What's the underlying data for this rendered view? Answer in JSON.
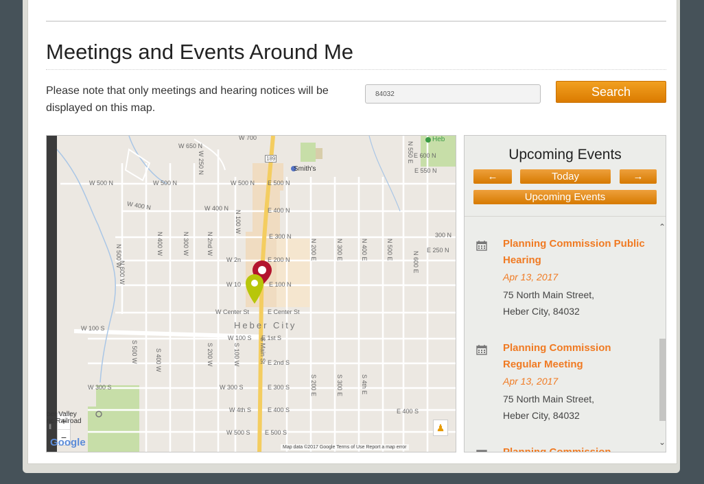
{
  "heading": "Meetings and Events Around Me",
  "note": "Please note that only meetings and hearing notices will be displayed on this map.",
  "search": {
    "value": "84032",
    "button_label": "Search"
  },
  "map": {
    "city_label": "Heber City",
    "google_logo": "Google",
    "attribution": "Map data ©2017 Google   Terms of Use   Report a map error",
    "zoom_in": "+",
    "zoom_out": "−",
    "place_labels": {
      "smiths": "Smith's",
      "heb": "Heb",
      "railroad_1": "ber Valley",
      "railroad_2": "ric Railroad",
      "hwy": "189"
    },
    "streets_h": {
      "w650n": "W 650 N",
      "w500n_a": "W 500 N",
      "w500n_b": "W 500 N",
      "w500n_c": "W 500 N",
      "e500n": "E 500 N",
      "e600n": "E 600 N",
      "e550n": "E 550 N",
      "w400n_a": "W 400 N",
      "w400n_b": "W 400 N",
      "e400n": "E 400 N",
      "e300n": "E 300 N",
      "n300n": "300 N",
      "e250n": "E 250 N",
      "w2n": "W 2n",
      "e200n": "E 200 N",
      "w10": "W 10",
      "e100n": "E 100 N",
      "w_center": "W Center St",
      "e_center": "E Center St",
      "w100s_a": "W 100 S",
      "w100s_b": "W 100 S",
      "e1st": "E 1st S",
      "e2nd": "E 2nd S",
      "w300s_a": "W 300 S",
      "w300s_b": "W 300 S",
      "e300s": "E 300 S",
      "w4th": "W 4th S",
      "e400s": "E 400 S",
      "e400s_b": "E 400 S",
      "w500s": "W 500 S",
      "e500s": "E 500 S",
      "w700": "W 700"
    },
    "streets_v": {
      "n600w": "N 600 W",
      "n500w": "N 500 W",
      "n400w": "N 400 W",
      "n300w": "N 300 W",
      "n2ndw": "N 2nd W",
      "n100w": "N 100 W",
      "n200e": "N 200 E",
      "n300e": "N 300 E",
      "n400e": "N 400 E",
      "n500e": "N 500 E",
      "n600e": "N 600 E",
      "n550e": "N 550 E",
      "w250n": "W 250 N",
      "s500w": "S 500 W",
      "s400w": "S 400 W",
      "s200w": "S 200 W",
      "s100w": "S 100 W",
      "smain": "S Main St",
      "s200e": "S 200 E",
      "s300e": "S 300 E",
      "s4the": "S 4th E",
      "e2": "E 2",
      "n0": "200"
    }
  },
  "panel": {
    "title": "Upcoming Events",
    "prev_label": "←",
    "today_label": "Today",
    "next_label": "→",
    "upcoming_label": "Upcoming Events",
    "events": [
      {
        "title": "Planning Commission Public Hearing",
        "date": "Apr 13, 2017",
        "address_1": "75 North Main Street,",
        "address_2": "Heber City, 84032"
      },
      {
        "title": "Planning Commission Regular Meeting",
        "date": "Apr 13, 2017",
        "address_1": "75 North Main Street,",
        "address_2": "Heber City, 84032"
      },
      {
        "title": "Planning Commission"
      }
    ],
    "scroll_up": "⌃",
    "scroll_down": "⌄"
  },
  "colors": {
    "accent": "#f07a22",
    "button": "#e08a0c",
    "marker_red": "#b3152e",
    "marker_green": "#b8c60a",
    "background": "#465259"
  }
}
